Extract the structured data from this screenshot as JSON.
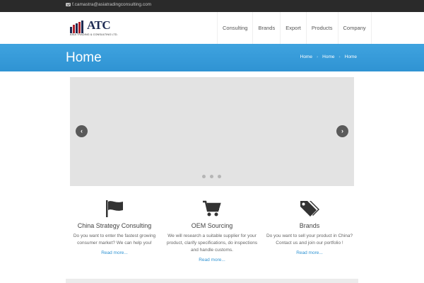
{
  "topbar": {
    "email": "f.camastra@asiatradingconsulting.com",
    "icon": "envelope-icon"
  },
  "logo": {
    "word": "ATC",
    "tagline": "ASIA TRADING & CONSULTING LTD.",
    "bar_colors": [
      "#1d2a52",
      "#b0202a",
      "#1d2a52",
      "#b0202a",
      "#1d2a52"
    ]
  },
  "nav": {
    "items": [
      "Consulting",
      "Brands",
      "Export",
      "Products",
      "Company"
    ]
  },
  "banner": {
    "title": "Home",
    "crumbs": [
      "Home",
      "Home",
      "Home"
    ],
    "color": "#2f93d3"
  },
  "slider": {
    "prev_icon": "chevron-left-icon",
    "next_icon": "chevron-right-icon",
    "slides": 3
  },
  "features": [
    {
      "title": "China Strategy Consulting",
      "text": "Do you want to enter the fastest growing consumer market? We can help you!",
      "link": "Read more...",
      "icon": "flag-icon"
    },
    {
      "title": "OEM Sourcing",
      "text": "We will research a suitable supplier for your product, clarify specifications, do inspections and handle customs.",
      "link": "Read more...",
      "icon": "shopping-cart-icon"
    },
    {
      "title": "Brands",
      "text": "Do you want to sell your product in China? Contact us and join our portfolio !",
      "link": "Read more...",
      "icon": "tags-icon"
    }
  ]
}
